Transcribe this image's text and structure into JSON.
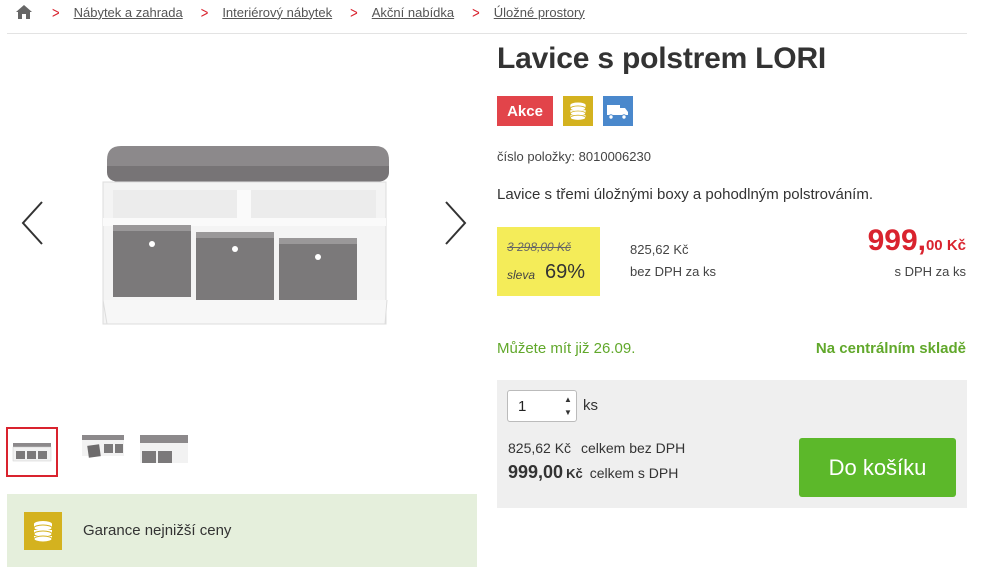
{
  "breadcrumb": {
    "items": [
      {
        "label": "Nábytek a zahrada"
      },
      {
        "label": "Interiérový nábytek"
      },
      {
        "label": "Akční nabídka"
      },
      {
        "label": "Úložné prostory"
      }
    ]
  },
  "product": {
    "title": "Lavice s polstrem LORI",
    "badge_label": "Akce",
    "sku": "číslo položky: 8010006230",
    "description": "Lavice s třemi úložnými boxy a pohodlným polstrováním."
  },
  "pricing": {
    "old_price": "3 298,00 Kč",
    "discount_label": "sleva",
    "discount_percent": "69%",
    "net_price": "825,62 Kč",
    "net_label": "bez DPH za ks",
    "gross_price_main": "999,",
    "gross_price_cents": "00 Kč",
    "gross_label": "s DPH za ks"
  },
  "availability": {
    "date": "Můžete mít již 26.09.",
    "stock": "Na centrálním skladě"
  },
  "cart": {
    "quantity": "1",
    "unit": "ks",
    "total_net_value": "825,62 Kč",
    "total_net_label": "celkem bez DPH",
    "total_gross_value": "999,00",
    "total_gross_currency": "Kč",
    "total_gross_label": "celkem s DPH",
    "add_button": "Do košíku"
  },
  "guarantee": {
    "label": "Garance nejnižší ceny"
  },
  "colors": {
    "accent_red": "#d9232e",
    "green": "#5cb82a",
    "highlight_yellow": "#f4ec59",
    "coin_gold": "#d4b21f",
    "truck_blue": "#4a88cc"
  }
}
